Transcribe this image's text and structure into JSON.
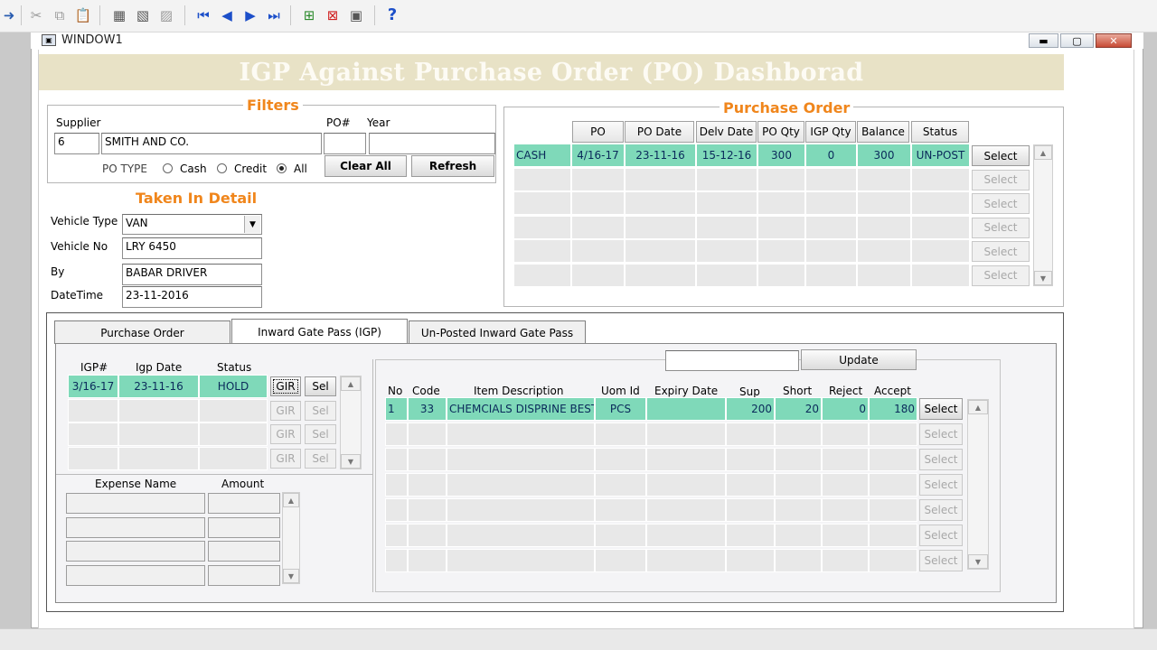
{
  "window": {
    "title": "WINDOW1"
  },
  "banner": {
    "title": "IGP Against Purchase Order (PO) Dashborad"
  },
  "filters": {
    "title": "Filters",
    "supplier_label": "Supplier",
    "supplier_code": "6",
    "supplier_name": "SMITH AND CO.",
    "po_label": "PO#",
    "po_value": "",
    "year_label": "Year",
    "year_value": "",
    "po_type_label": "PO TYPE",
    "po_type_options": [
      {
        "label": "Cash",
        "selected": false
      },
      {
        "label": "Credit",
        "selected": false
      },
      {
        "label": "All",
        "selected": true
      }
    ],
    "clear_all_label": "Clear All",
    "refresh_label": "Refresh"
  },
  "taken_in_detail": {
    "title": "Taken In Detail",
    "vehicle_type_label": "Vehicle Type",
    "vehicle_type_value": "VAN",
    "vehicle_no_label": "Vehicle No",
    "vehicle_no_value": "LRY 6450",
    "by_label": "By",
    "by_value": "BABAR DRIVER",
    "datetime_label": "DateTime",
    "datetime_value": "23-11-2016"
  },
  "purchase_order": {
    "title": "Purchase Order",
    "columns": [
      "PO",
      "PO Date",
      "Delv Date",
      "PO Qty",
      "IGP Qty",
      "Balance",
      "Status"
    ],
    "rows": [
      {
        "type": "CASH",
        "po": "4/16-17",
        "po_date": "23-11-16",
        "delv_date": "15-12-16",
        "po_qty": "300",
        "igp_qty": "0",
        "balance": "300",
        "status": "UN-POST"
      }
    ],
    "select_label": "Select"
  },
  "tabs": [
    {
      "label": "Purchase Order",
      "active": false
    },
    {
      "label": "Inward Gate Pass (IGP)",
      "active": true
    },
    {
      "label": "Un-Posted Inward Gate Pass",
      "active": false
    }
  ],
  "igp": {
    "columns": [
      "IGP#",
      "Igp Date",
      "Status"
    ],
    "rows": [
      {
        "igp": "3/16-17",
        "igp_date": "23-11-16",
        "status": "HOLD"
      }
    ],
    "gir_label": "GIR",
    "sel_label": "Sel"
  },
  "expense": {
    "columns": [
      "Expense Name",
      "Amount"
    ]
  },
  "items": {
    "update_input": "",
    "update_label": "Update",
    "columns": [
      "No",
      "Code",
      "Item Description",
      "Uom Id",
      "Expiry Date",
      "Sup",
      "Short",
      "Reject",
      "Accept"
    ],
    "rows": [
      {
        "no": "1",
        "code": "33",
        "description": "CHEMCIALS DISPRINE BEST",
        "uom": "PCS",
        "expiry": "",
        "sup": "200",
        "short": "20",
        "reject": "0",
        "accept": "180"
      }
    ],
    "select_label": "Select"
  }
}
